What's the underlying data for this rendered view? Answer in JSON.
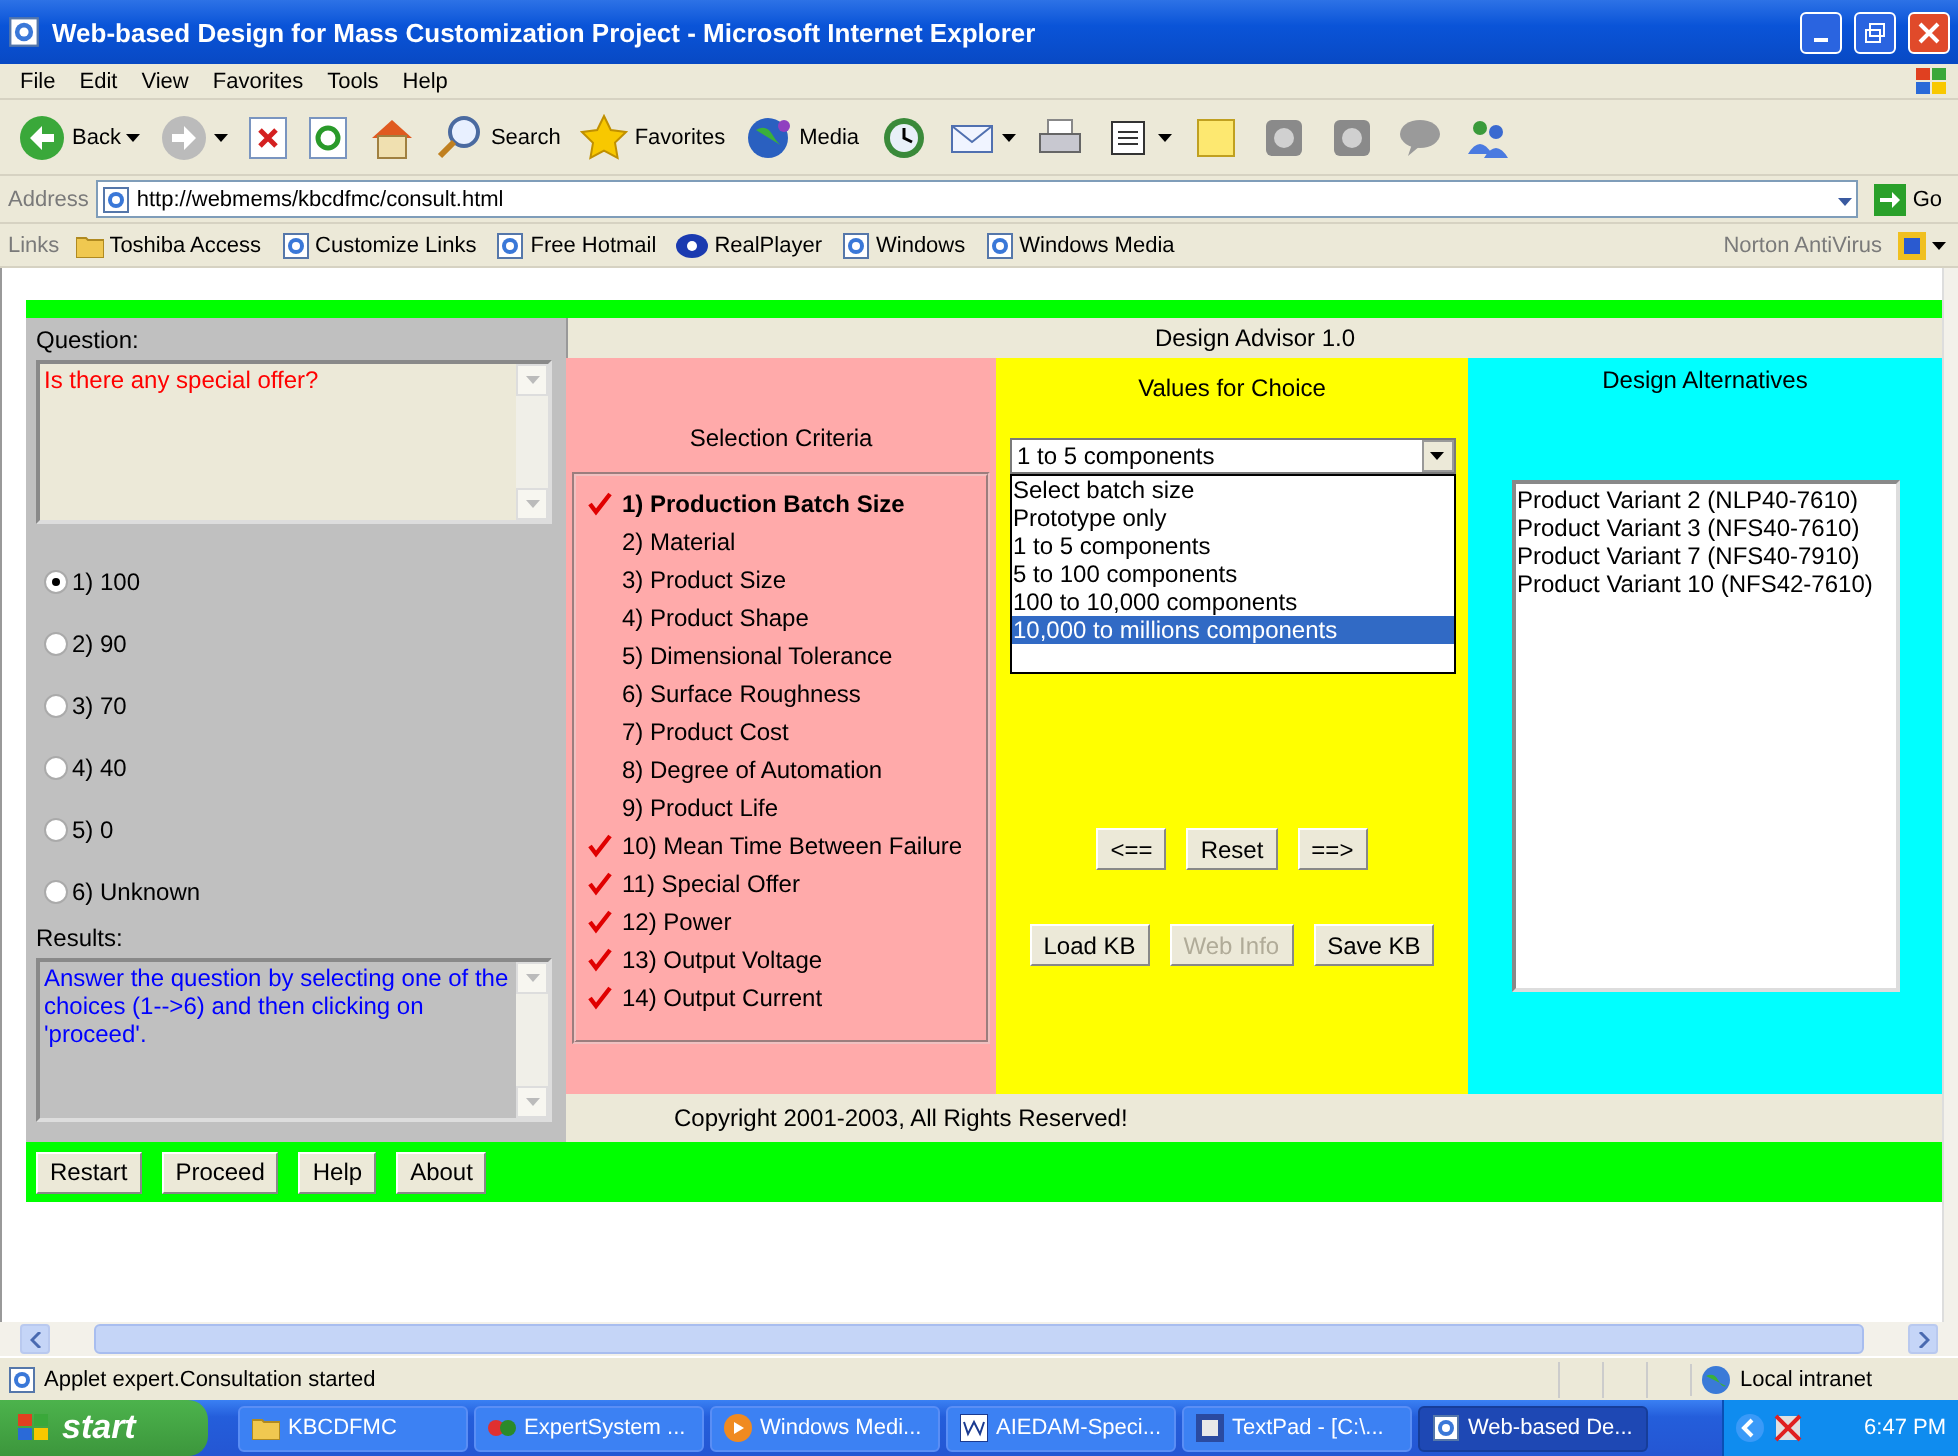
{
  "window": {
    "title": "Web-based Design for Mass Customization Project - Microsoft Internet Explorer"
  },
  "menu": [
    "File",
    "Edit",
    "View",
    "Favorites",
    "Tools",
    "Help"
  ],
  "toolbar": [
    {
      "kind": "back",
      "label": "Back"
    },
    {
      "kind": "forward"
    },
    {
      "kind": "stop"
    },
    {
      "kind": "refresh"
    },
    {
      "kind": "home"
    },
    {
      "kind": "search",
      "label": "Search"
    },
    {
      "kind": "favorites",
      "label": "Favorites"
    },
    {
      "kind": "media",
      "label": "Media"
    },
    {
      "kind": "history"
    },
    {
      "kind": "mail"
    },
    {
      "kind": "print"
    },
    {
      "kind": "edit"
    },
    {
      "kind": "note"
    },
    {
      "kind": "tool"
    },
    {
      "kind": "tool"
    },
    {
      "kind": "chat"
    },
    {
      "kind": "people"
    }
  ],
  "address": {
    "label": "Address",
    "url": "http://webmems/kbcdfmc/consult.html",
    "go": "Go"
  },
  "links": {
    "label": "Links",
    "items": [
      {
        "kind": "folder",
        "label": "Toshiba Access"
      },
      {
        "kind": "page",
        "label": "Customize Links"
      },
      {
        "kind": "page",
        "label": "Free Hotmail"
      },
      {
        "kind": "player",
        "label": "RealPlayer"
      },
      {
        "kind": "page",
        "label": "Windows"
      },
      {
        "kind": "page",
        "label": "Windows Media"
      }
    ],
    "right": "Norton AntiVirus"
  },
  "applet": {
    "question_label": "Question:",
    "question": "Is there any special offer?",
    "choices": [
      {
        "label": "1) 100",
        "selected": true
      },
      {
        "label": "2) 90",
        "selected": false
      },
      {
        "label": "3) 70",
        "selected": false
      },
      {
        "label": "4) 40",
        "selected": false
      },
      {
        "label": "5) 0",
        "selected": false
      },
      {
        "label": "6) Unknown",
        "selected": false
      }
    ],
    "results_label": "Results:",
    "results": "Answer the question by selecting one of the choices (1-->6) and then clicking on 'proceed'.",
    "header": "Design Advisor 1.0",
    "criteria": {
      "title": "Selection Criteria",
      "items": [
        {
          "label": "1) Production Batch Size",
          "checked": true,
          "selected": true
        },
        {
          "label": "2) Material",
          "checked": false,
          "selected": false
        },
        {
          "label": "3) Product Size",
          "checked": false,
          "selected": false
        },
        {
          "label": "4) Product Shape",
          "checked": false,
          "selected": false
        },
        {
          "label": "5) Dimensional Tolerance",
          "checked": false,
          "selected": false
        },
        {
          "label": "6) Surface Roughness",
          "checked": false,
          "selected": false
        },
        {
          "label": "7) Product Cost",
          "checked": false,
          "selected": false
        },
        {
          "label": "8) Degree of Automation",
          "checked": false,
          "selected": false
        },
        {
          "label": "9) Product Life",
          "checked": false,
          "selected": false
        },
        {
          "label": "10) Mean Time Between Failure",
          "checked": true,
          "selected": false
        },
        {
          "label": "11) Special Offer",
          "checked": true,
          "selected": false
        },
        {
          "label": "12) Power",
          "checked": true,
          "selected": false
        },
        {
          "label": "13) Output Voltage",
          "checked": true,
          "selected": false
        },
        {
          "label": "14) Output Current",
          "checked": true,
          "selected": false
        }
      ]
    },
    "values": {
      "title": "Values for Choice",
      "dropdown_value": "1 to 5 components",
      "options": [
        {
          "label": "Select batch size",
          "selected": false
        },
        {
          "label": "Prototype only",
          "selected": false
        },
        {
          "label": "1 to 5 components",
          "selected": false
        },
        {
          "label": "5 to 100 components",
          "selected": false
        },
        {
          "label": "100 to 10,000 components",
          "selected": false
        },
        {
          "label": "10,000 to millions components",
          "selected": true
        }
      ],
      "nav_buttons": [
        "<==",
        "Reset",
        "==>"
      ],
      "kb_buttons": [
        {
          "label": "Load KB",
          "disabled": false
        },
        {
          "label": "Web Info",
          "disabled": true
        },
        {
          "label": "Save KB",
          "disabled": false
        }
      ]
    },
    "alternatives": {
      "title": "Design Alternatives",
      "items": [
        "Product Variant 2 (NLP40-7610)",
        "Product Variant 3 (NFS40-7610)",
        "Product Variant 7 (NFS40-7910)",
        "Product Variant 10 (NFS42-7610)"
      ]
    },
    "copyright": "Copyright 2001-2003, All Rights Reserved!",
    "buttons": [
      "Restart",
      "Proceed",
      "Help",
      "About"
    ]
  },
  "status_bar": {
    "text": "Applet expert.Consultation started",
    "zone": "Local intranet"
  },
  "taskbar": {
    "start": "start",
    "tasks": [
      {
        "label": "KBCDFMC",
        "kind": "folder",
        "selected": false
      },
      {
        "label": "ExpertSystem ...",
        "kind": "app",
        "selected": false
      },
      {
        "label": "Windows Medi...",
        "kind": "player",
        "selected": false
      },
      {
        "label": "AIEDAM-Speci...",
        "kind": "word",
        "selected": false
      },
      {
        "label": "TextPad - [C:\\...",
        "kind": "editor",
        "selected": false
      },
      {
        "label": "Web-based De...",
        "kind": "ie",
        "selected": true
      }
    ],
    "clock": "6:47 PM"
  }
}
